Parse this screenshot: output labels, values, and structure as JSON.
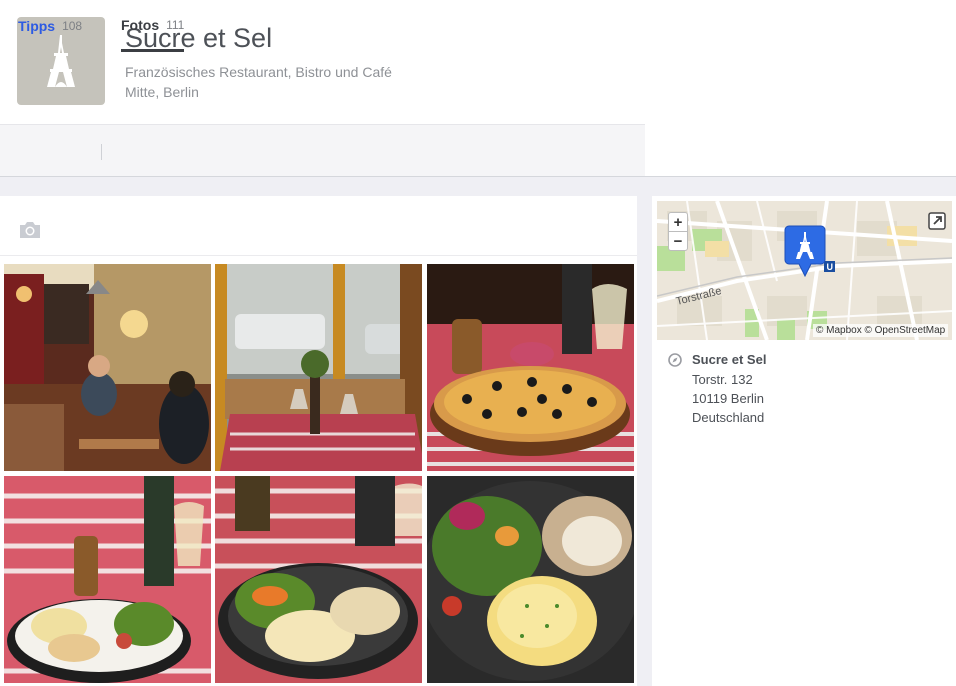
{
  "venue": {
    "name": "Sucre et Sel",
    "categories": "Französisches Restaurant, Bistro und Café",
    "location": "Mitte, Berlin"
  },
  "tabs": [
    {
      "label": "Tipps",
      "count": "108"
    },
    {
      "label": "Fotos",
      "count": "111"
    }
  ],
  "photos": [
    "bistro-interior-photo",
    "window-table-photo",
    "pizza-photo",
    "salad-plate-photo",
    "mashed-potato-plate-photo",
    "salad-mash-plate-photo"
  ],
  "map": {
    "street_label": "Torstraße",
    "transit_label": "U",
    "attribution": "© Mapbox © OpenStreetMap",
    "zoom_in": "+",
    "zoom_out": "−"
  },
  "address": {
    "name": "Sucre et Sel",
    "street": "Torstr. 132",
    "city": "10119 Berlin",
    "country": "Deutschland"
  },
  "colors": {
    "accent": "#2d5be3",
    "marker": "#2d6be4",
    "icon_bg": "#c5c3bb"
  }
}
